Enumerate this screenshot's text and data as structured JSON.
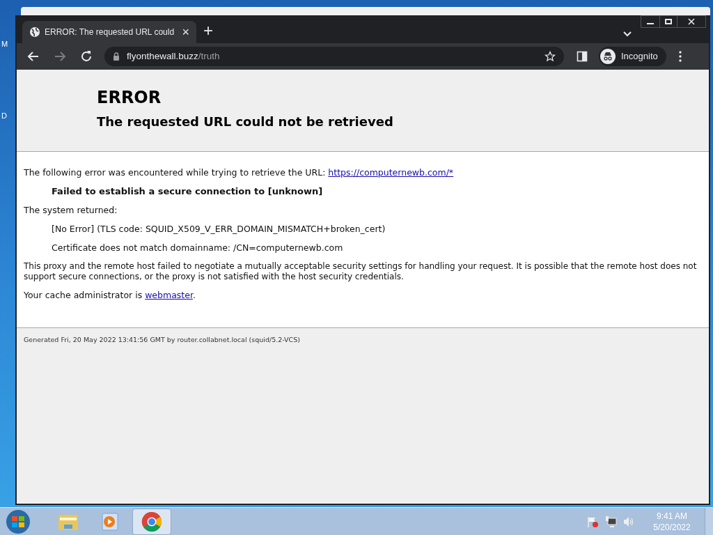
{
  "desktop": {
    "icon_labels": [
      "M",
      "D"
    ]
  },
  "browser": {
    "tabs": [
      {
        "title": "ERROR: The requested URL could",
        "close": "×",
        "selected": true
      }
    ],
    "new_tab": "+",
    "address": {
      "host": "flyonthewall.buzz",
      "path": "/truth"
    },
    "profile": "Incognito"
  },
  "page": {
    "title": "ERROR",
    "subtitle": "The requested URL could not be retrieved",
    "intro": "The following error was encountered while trying to retrieve the URL: ",
    "intro_link": "https://computernewb.com/*",
    "error": "Failed to establish a secure connection to [unknown]",
    "system_label": "The system returned:",
    "details": [
      "[No Error] (TLS code: SQUID_X509_V_ERR_DOMAIN_MISMATCH+broken_cert)",
      "Certificate does not match domainname: /CN=computernewb.com"
    ],
    "explanation": "This proxy and the remote host failed to negotiate a mutually acceptable security settings for handling your request. It is possible that the remote host does not support secure connections, or the proxy is not satisfied with the host security credentials.",
    "admin_text": "Your cache administrator is ",
    "admin_link": "webmaster",
    "admin_end": ".",
    "footer": "Generated Fri, 20 May 2022 13:41:56 GMT by router.collabnet.local (squid/5.2-VCS)"
  },
  "taskbar": {
    "apps": [
      {
        "kind": "explorer",
        "selected": false
      },
      {
        "kind": "media",
        "selected": false
      },
      {
        "kind": "chrome",
        "selected": true
      }
    ],
    "time": "9:41 AM",
    "date": "5/20/2022"
  }
}
